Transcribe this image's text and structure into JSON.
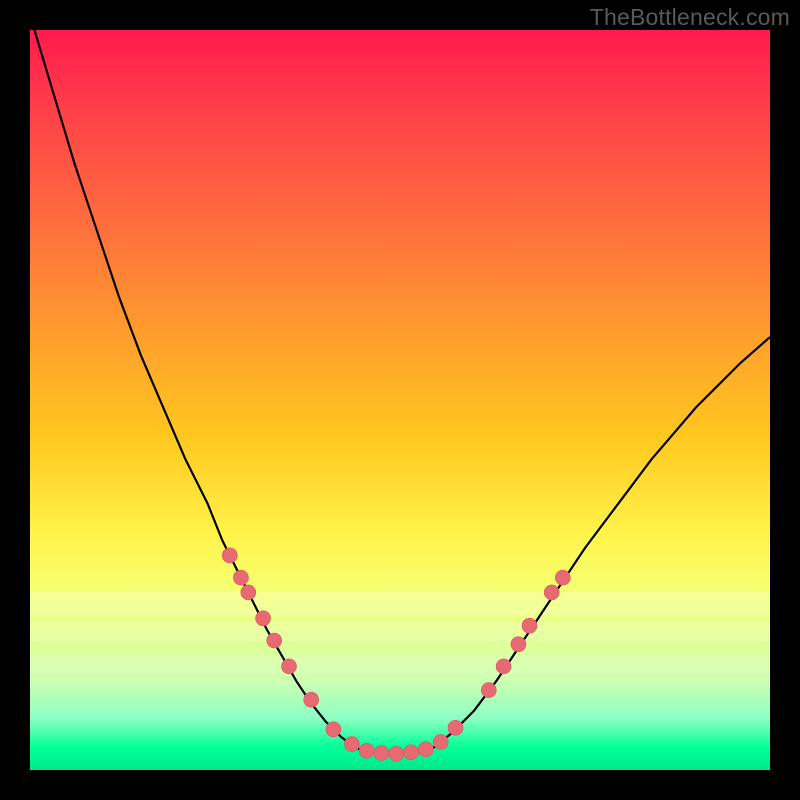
{
  "watermark": "TheBottleneck.com",
  "colors": {
    "frame": "#000000",
    "gradient_top": "#ff1a4d",
    "gradient_bottom": "#00e88c",
    "curve": "#000000",
    "bead": "#e76a72"
  },
  "chart_data": {
    "type": "line",
    "title": "",
    "xlabel": "",
    "ylabel": "",
    "xlim": [
      0,
      100
    ],
    "ylim": [
      0,
      100
    ],
    "grid": false,
    "note": "Axes carry no tick labels in the source image; x and y are normalized 0–100. Lower y = bottom of plot.",
    "series": [
      {
        "name": "left-branch",
        "x": [
          0,
          3,
          6,
          9,
          12,
          15,
          18,
          21,
          24,
          26,
          28,
          30,
          32,
          34,
          36,
          38,
          40,
          42,
          44,
          45.5
        ],
        "y": [
          102,
          92,
          82,
          73,
          64,
          56,
          49,
          42,
          36,
          31,
          27,
          23,
          19,
          15.5,
          12,
          9,
          6.5,
          4.5,
          3,
          2.5
        ]
      },
      {
        "name": "valley-floor",
        "x": [
          45.5,
          47,
          48.5,
          50,
          51.5,
          53,
          54.5
        ],
        "y": [
          2.5,
          2.3,
          2.2,
          2.2,
          2.3,
          2.5,
          3
        ]
      },
      {
        "name": "right-branch",
        "x": [
          54.5,
          57,
          60,
          63,
          66,
          69,
          72,
          75,
          78,
          81,
          84,
          87,
          90,
          93,
          96,
          100
        ],
        "y": [
          3,
          5,
          8,
          12,
          16.5,
          21,
          25.5,
          30,
          34,
          38,
          42,
          45.5,
          49,
          52,
          55,
          58.5
        ]
      }
    ],
    "markers": {
      "name": "beads",
      "points": [
        {
          "x": 27.0,
          "y": 29.0
        },
        {
          "x": 28.5,
          "y": 26.0
        },
        {
          "x": 29.5,
          "y": 24.0
        },
        {
          "x": 31.5,
          "y": 20.5
        },
        {
          "x": 33.0,
          "y": 17.5
        },
        {
          "x": 35.0,
          "y": 14.0
        },
        {
          "x": 38.0,
          "y": 9.5
        },
        {
          "x": 41.0,
          "y": 5.5
        },
        {
          "x": 43.5,
          "y": 3.5
        },
        {
          "x": 45.5,
          "y": 2.6
        },
        {
          "x": 47.5,
          "y": 2.3
        },
        {
          "x": 49.5,
          "y": 2.2
        },
        {
          "x": 51.5,
          "y": 2.4
        },
        {
          "x": 53.5,
          "y": 2.8
        },
        {
          "x": 55.5,
          "y": 3.8
        },
        {
          "x": 57.5,
          "y": 5.7
        },
        {
          "x": 62.0,
          "y": 10.8
        },
        {
          "x": 64.0,
          "y": 14.0
        },
        {
          "x": 66.0,
          "y": 17.0
        },
        {
          "x": 67.5,
          "y": 19.5
        },
        {
          "x": 70.5,
          "y": 24.0
        },
        {
          "x": 72.0,
          "y": 26.0
        }
      ]
    }
  }
}
